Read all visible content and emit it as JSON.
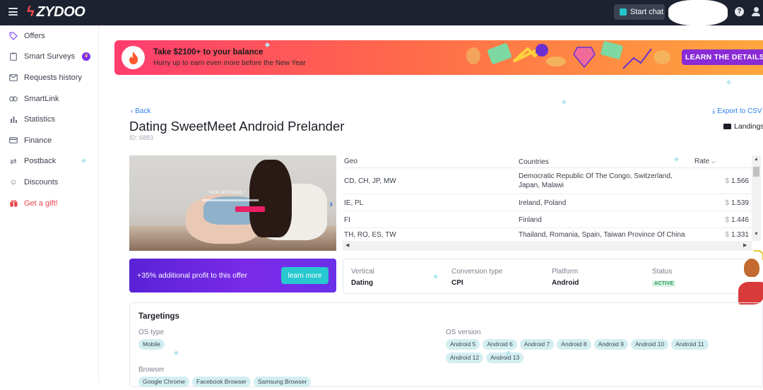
{
  "topbar": {
    "logo_text": "ZYDOO",
    "start_chat_label": "Start chat",
    "help_label": "?"
  },
  "sidebar": {
    "items": [
      {
        "label": "Offers",
        "icon": "tag-icon"
      },
      {
        "label": "Smart Surveys",
        "icon": "clipboard-icon",
        "badge": "crown"
      },
      {
        "label": "Requests history",
        "icon": "mail-icon"
      },
      {
        "label": "SmartLink",
        "icon": "link-icon"
      },
      {
        "label": "Statistics",
        "icon": "bar-chart-icon"
      },
      {
        "label": "Finance",
        "icon": "card-icon"
      },
      {
        "label": "Postback",
        "icon": "arrows-icon"
      },
      {
        "label": "Discounts",
        "icon": "smile-icon"
      },
      {
        "label": "Get a gift!",
        "icon": "gift-icon"
      }
    ]
  },
  "banner": {
    "title": "Take $2100+ to your balance",
    "subtitle": "Hurry up to earn even more before the New Year",
    "cta": "LEARN THE DETAILS"
  },
  "offer": {
    "back_label": "Back",
    "export_label": "Export to CSV",
    "title": "Dating SweetMeet Android Prelander",
    "id_text": "ID: 6883",
    "landings_label": "Landings",
    "preview_message": "NEW MESSAGE !"
  },
  "rates_table": {
    "headers": {
      "geo": "Geo",
      "countries": "Countries",
      "rate": "Rate"
    },
    "currency": "$",
    "rows": [
      {
        "geo": "CD, CH, JP, MW",
        "countries": "Democratic Republic Of The Congo, Switzerland, Japan, Malawi",
        "rate": "1.566"
      },
      {
        "geo": "IE, PL",
        "countries": "Ireland, Poland",
        "rate": "1.539"
      },
      {
        "geo": "FI",
        "countries": "Finland",
        "rate": "1.446"
      },
      {
        "geo": "TH, RO, ES, TW",
        "countries": "Thailand, Romania, Spain, Taiwan Province Of China",
        "rate": "1.331"
      }
    ]
  },
  "promo": {
    "text": "+35% additional profit to this offer",
    "button": "learn more"
  },
  "meta": {
    "vertical_label": "Vertical",
    "vertical_value": "Dating",
    "conversion_label": "Conversion type",
    "conversion_value": "CPI",
    "platform_label": "Platform",
    "platform_value": "Android",
    "status_label": "Status",
    "status_value": "ACTIVE"
  },
  "targetings": {
    "title": "Targetings",
    "os_type_label": "OS type",
    "os_type": [
      "Mobile"
    ],
    "os_version_label": "OS version",
    "os_versions": [
      "Android 5",
      "Android 6",
      "Android 7",
      "Android 8",
      "Android 9",
      "Android 10",
      "Android 11",
      "Android 12",
      "Android 13"
    ],
    "browser_label": "Browser",
    "browsers": [
      "Google Chrome",
      "Facebook Browser",
      "Samsung Browser"
    ]
  },
  "colors": {
    "topbar": "#1c2230",
    "accent_purple": "#7b2be8",
    "accent_teal": "#27c8cf",
    "link_blue": "#2f80ed"
  }
}
